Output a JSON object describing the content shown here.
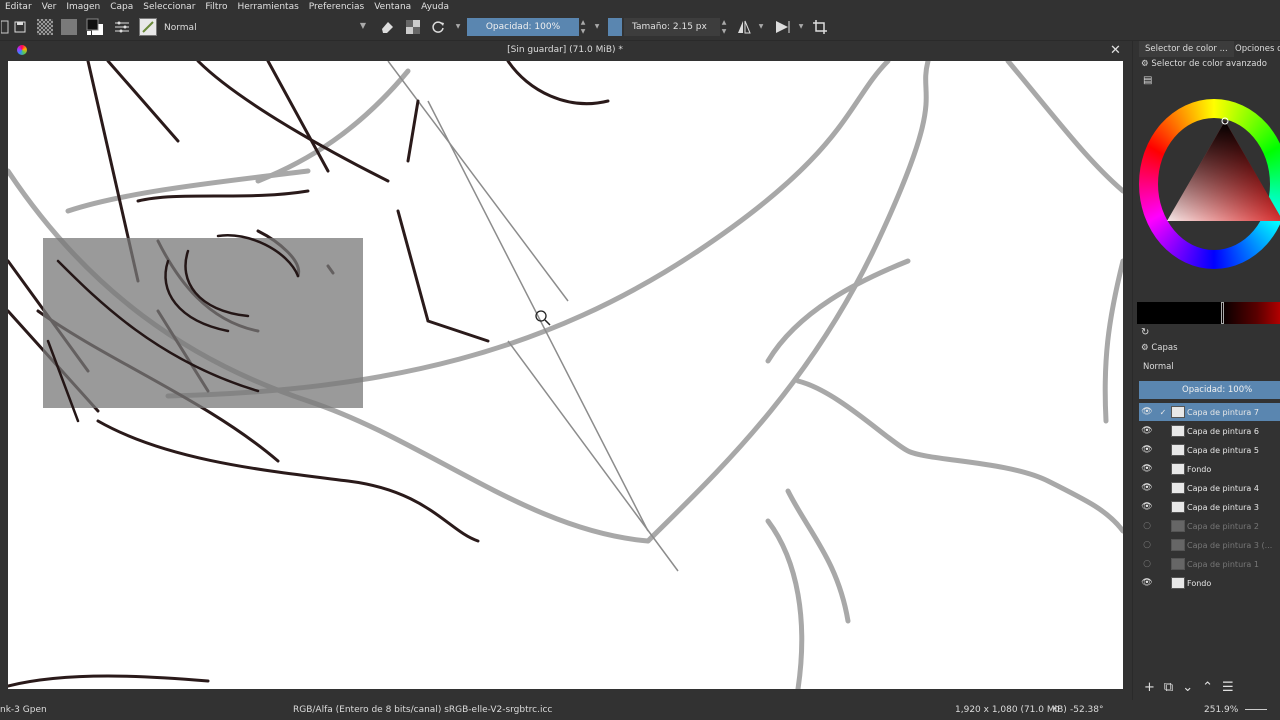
{
  "menu": [
    "Editar",
    "Ver",
    "Imagen",
    "Capa",
    "Seleccionar",
    "Filtro",
    "Herramientas",
    "Preferencias",
    "Ventana",
    "Ayuda"
  ],
  "toolbar": {
    "blend_mode": "Normal",
    "opacity_label": "Opacidad: 100%",
    "size_label": "Tamaño: 2.15 px"
  },
  "document": {
    "title": "[Sin guardar]  (71.0 MiB) *"
  },
  "status": {
    "brush": "nk-3 Gpen",
    "color_info": "RGB/Alfa (Entero de 8 bits/canal)  sRGB-elle-V2-srgbtrc.icc",
    "dimensions": "1,920 x 1,080 (71.0 MiB)",
    "rotation": "-52.38°",
    "zoom": "251.9%"
  },
  "dock": {
    "tab_color": "Selector de color ...",
    "tab_options": "Opciones de",
    "advanced_selector": "Selector de color avanzado",
    "layers_title": "Capas",
    "layers_blend": "Normal",
    "layers_opacity": "Opacidad:  100%",
    "layers": [
      {
        "name": "Capa de pintura 7",
        "visible": true,
        "selected": true,
        "dim": false
      },
      {
        "name": "Capa de pintura 6",
        "visible": true,
        "selected": false,
        "dim": false
      },
      {
        "name": "Capa de pintura 5",
        "visible": true,
        "selected": false,
        "dim": false
      },
      {
        "name": "Fondo",
        "visible": true,
        "selected": false,
        "dim": false
      },
      {
        "name": "Capa de pintura 4",
        "visible": true,
        "selected": false,
        "dim": false
      },
      {
        "name": "Capa de pintura 3",
        "visible": true,
        "selected": false,
        "dim": false
      },
      {
        "name": "Capa de pintura 2",
        "visible": false,
        "selected": false,
        "dim": true
      },
      {
        "name": "Capa de pintura 3 (...",
        "visible": false,
        "selected": false,
        "dim": true
      },
      {
        "name": "Capa de pintura 1",
        "visible": false,
        "selected": false,
        "dim": true
      },
      {
        "name": "Fondo",
        "visible": true,
        "selected": false,
        "dim": false
      }
    ]
  }
}
